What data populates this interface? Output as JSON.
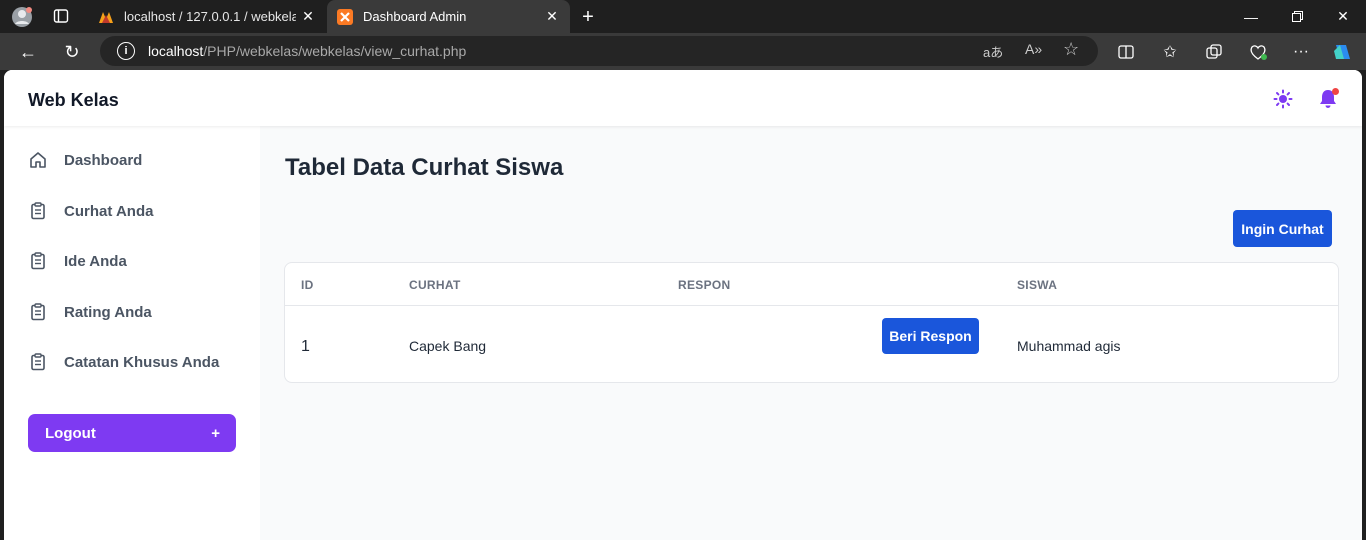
{
  "browser": {
    "tabs": [
      {
        "title": "localhost / 127.0.0.1 / webkelas / ",
        "active": false
      },
      {
        "title": "Dashboard Admin",
        "active": true
      }
    ],
    "url_host": "localhost",
    "url_path": "/PHP/webkelas/webkelas/view_curhat.php"
  },
  "brand": "Web Kelas",
  "sidebar": {
    "items": [
      {
        "label": "Dashboard",
        "icon": "home-icon"
      },
      {
        "label": "Curhat Anda",
        "icon": "clipboard-icon"
      },
      {
        "label": "Ide Anda",
        "icon": "clipboard-icon"
      },
      {
        "label": "Rating Anda",
        "icon": "clipboard-icon"
      },
      {
        "label": "Catatan Khusus Anda",
        "icon": "clipboard-icon"
      }
    ],
    "logout_label": "Logout",
    "logout_symbol": "+"
  },
  "main": {
    "title": "Tabel Data Curhat Siswa",
    "add_button": "Ingin Curhat",
    "table": {
      "headers": [
        "ID",
        "CURHAT",
        "RESPON",
        "SISWA"
      ],
      "rows": [
        {
          "id": "1",
          "curhat": "Capek Bang",
          "respon_button": "Beri Respon",
          "siswa": "Muhammad agis"
        }
      ]
    }
  },
  "colors": {
    "accent_purple": "#7e3af2",
    "accent_blue": "#1a56db",
    "notif_red": "#ef4444"
  }
}
